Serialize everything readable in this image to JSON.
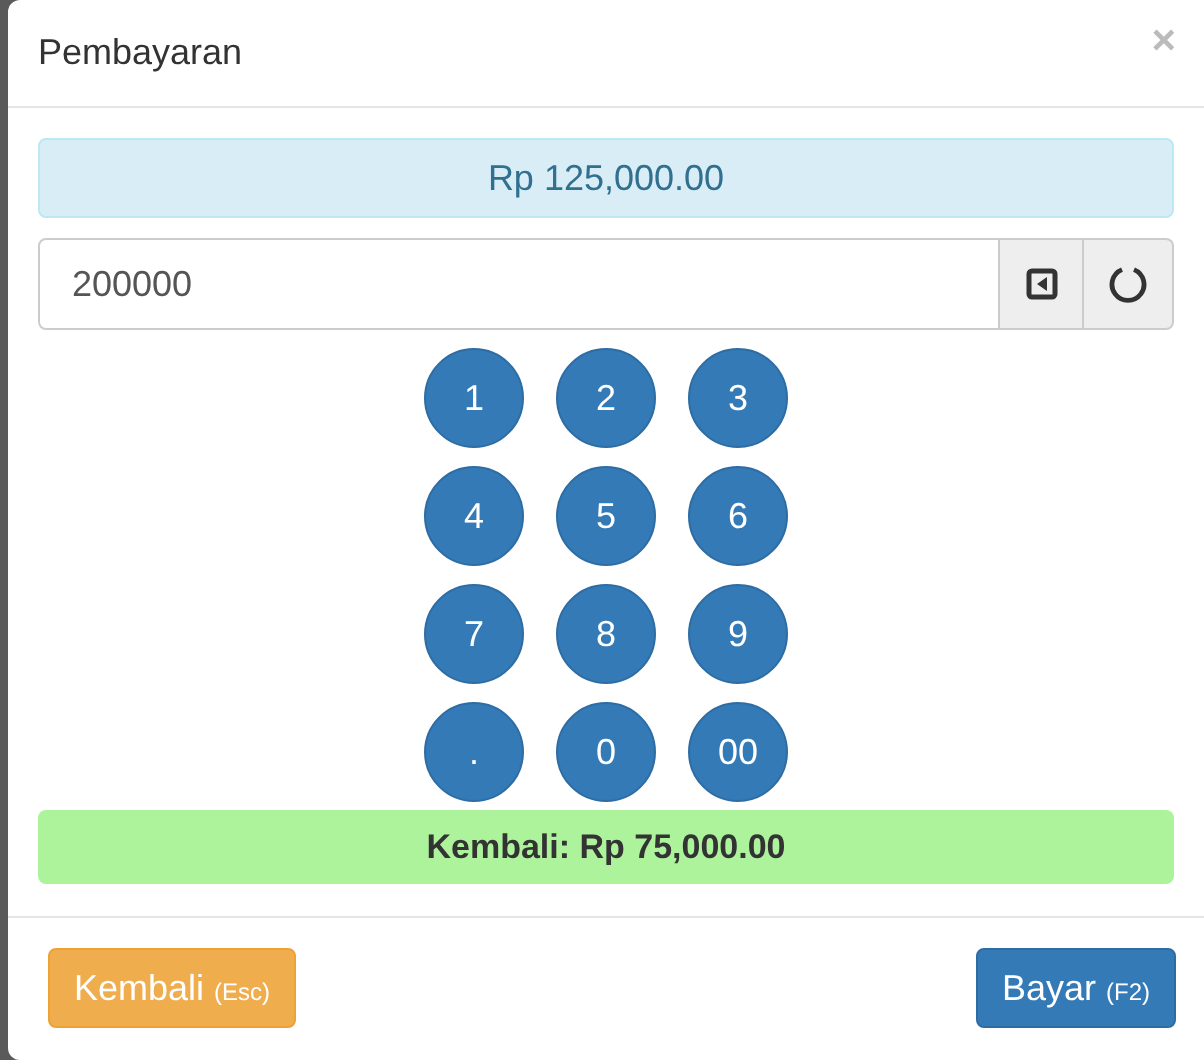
{
  "dialog": {
    "title": "Pembayaran",
    "close": "×"
  },
  "total": "Rp 125,000.00",
  "amount_field": {
    "value": "200000"
  },
  "keypad": [
    [
      "1",
      "2",
      "3"
    ],
    [
      "4",
      "5",
      "6"
    ],
    [
      "7",
      "8",
      "9"
    ],
    [
      ".",
      "0",
      "00"
    ]
  ],
  "change": "Kembali: Rp 75,000.00",
  "buttons": [
    {
      "kind": "warning",
      "label": "Kembali",
      "shortcut": "(Esc)"
    },
    {
      "kind": "primary",
      "label": "Bayar",
      "shortcut": "(F2)"
    }
  ]
}
